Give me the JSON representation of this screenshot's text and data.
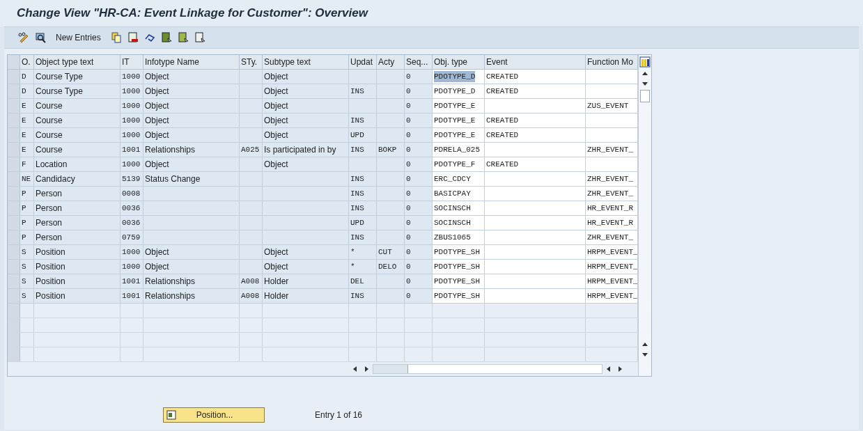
{
  "window": {
    "title": "Change View \"HR-CA: Event Linkage for Customer\": Overview"
  },
  "toolbar": {
    "new_entries": "New Entries"
  },
  "table": {
    "columns": [
      {
        "label": "O.",
        "kind": "keycode"
      },
      {
        "label": "Object type text",
        "kind": "keytext"
      },
      {
        "label": "IT",
        "kind": "keycode"
      },
      {
        "label": "Infotype Name",
        "kind": "keytext"
      },
      {
        "label": "STy.",
        "kind": "keycode"
      },
      {
        "label": "Subtype text",
        "kind": "keytext"
      },
      {
        "label": "Updat",
        "kind": "keycode"
      },
      {
        "label": "Acty",
        "kind": "keycode"
      },
      {
        "label": "Seq...",
        "kind": "keycode"
      },
      {
        "label": "Obj. type",
        "kind": "entry"
      },
      {
        "label": "Event",
        "kind": "entry"
      },
      {
        "label": "Function Mo",
        "kind": "entry"
      }
    ],
    "rows": [
      {
        "obj_type_highlighted": true,
        "cells": [
          "D",
          "Course Type",
          "1000",
          "Object",
          "",
          "Object",
          "",
          "",
          "0",
          "PDOTYPE_D",
          "CREATED",
          ""
        ]
      },
      {
        "obj_type_highlighted": false,
        "cells": [
          "D",
          "Course Type",
          "1000",
          "Object",
          "",
          "Object",
          "INS",
          "",
          "0",
          "PDOTYPE_D",
          "CREATED",
          ""
        ]
      },
      {
        "obj_type_highlighted": false,
        "cells": [
          "E",
          "Course",
          "1000",
          "Object",
          "",
          "Object",
          "",
          "",
          "0",
          "PDOTYPE_E",
          "",
          "ZUS_EVENT"
        ]
      },
      {
        "obj_type_highlighted": false,
        "cells": [
          "E",
          "Course",
          "1000",
          "Object",
          "",
          "Object",
          "INS",
          "",
          "0",
          "PDOTYPE_E",
          "CREATED",
          ""
        ]
      },
      {
        "obj_type_highlighted": false,
        "cells": [
          "E",
          "Course",
          "1000",
          "Object",
          "",
          "Object",
          "UPD",
          "",
          "0",
          "PDOTYPE_E",
          "CREATED",
          ""
        ]
      },
      {
        "obj_type_highlighted": false,
        "cells": [
          "E",
          "Course",
          "1001",
          "Relationships",
          "A025",
          "Is participated in by",
          "INS",
          "BOKP",
          "0",
          "PDRELA_025",
          "",
          "ZHR_EVENT_"
        ]
      },
      {
        "obj_type_highlighted": false,
        "cells": [
          "F",
          "Location",
          "1000",
          "Object",
          "",
          "Object",
          "",
          "",
          "0",
          "PDOTYPE_F",
          "CREATED",
          ""
        ]
      },
      {
        "obj_type_highlighted": false,
        "cells": [
          "NE",
          "Candidacy",
          "5139",
          "Status Change",
          "",
          "",
          "INS",
          "",
          "0",
          "ERC_CDCY",
          "",
          "ZHR_EVENT_"
        ]
      },
      {
        "obj_type_highlighted": false,
        "cells": [
          "P",
          "Person",
          "0008",
          "",
          "",
          "",
          "INS",
          "",
          "0",
          "BASICPAY",
          "",
          "ZHR_EVENT_"
        ]
      },
      {
        "obj_type_highlighted": false,
        "cells": [
          "P",
          "Person",
          "0036",
          "",
          "",
          "",
          "INS",
          "",
          "0",
          "SOCINSCH",
          "",
          "HR_EVENT_R"
        ]
      },
      {
        "obj_type_highlighted": false,
        "cells": [
          "P",
          "Person",
          "0036",
          "",
          "",
          "",
          "UPD",
          "",
          "0",
          "SOCINSCH",
          "",
          "HR_EVENT_R"
        ]
      },
      {
        "obj_type_highlighted": false,
        "cells": [
          "P",
          "Person",
          "0759",
          "",
          "",
          "",
          "INS",
          "",
          "0",
          "ZBUS1065",
          "",
          "ZHR_EVENT_"
        ]
      },
      {
        "obj_type_highlighted": false,
        "cells": [
          "S",
          "Position",
          "1000",
          "Object",
          "",
          "Object",
          "*",
          "CUT",
          "0",
          "PDOTYPE_SH",
          "",
          "HRPM_EVENT_"
        ]
      },
      {
        "obj_type_highlighted": false,
        "cells": [
          "S",
          "Position",
          "1000",
          "Object",
          "",
          "Object",
          "*",
          "DELO",
          "0",
          "PDOTYPE_SH",
          "",
          "HRPM_EVENT_"
        ]
      },
      {
        "obj_type_highlighted": false,
        "cells": [
          "S",
          "Position",
          "1001",
          "Relationships",
          "A008",
          "Holder",
          "DEL",
          "",
          "0",
          "PDOTYPE_SH",
          "",
          "HRPM_EVENT_"
        ]
      },
      {
        "obj_type_highlighted": false,
        "cells": [
          "S",
          "Position",
          "1001",
          "Relationships",
          "A008",
          "Holder",
          "INS",
          "",
          "0",
          "PDOTYPE_SH",
          "",
          "HRPM_EVENT_"
        ]
      }
    ]
  },
  "footer": {
    "position_button": "Position...",
    "entry_info": "Entry 1 of 16"
  }
}
